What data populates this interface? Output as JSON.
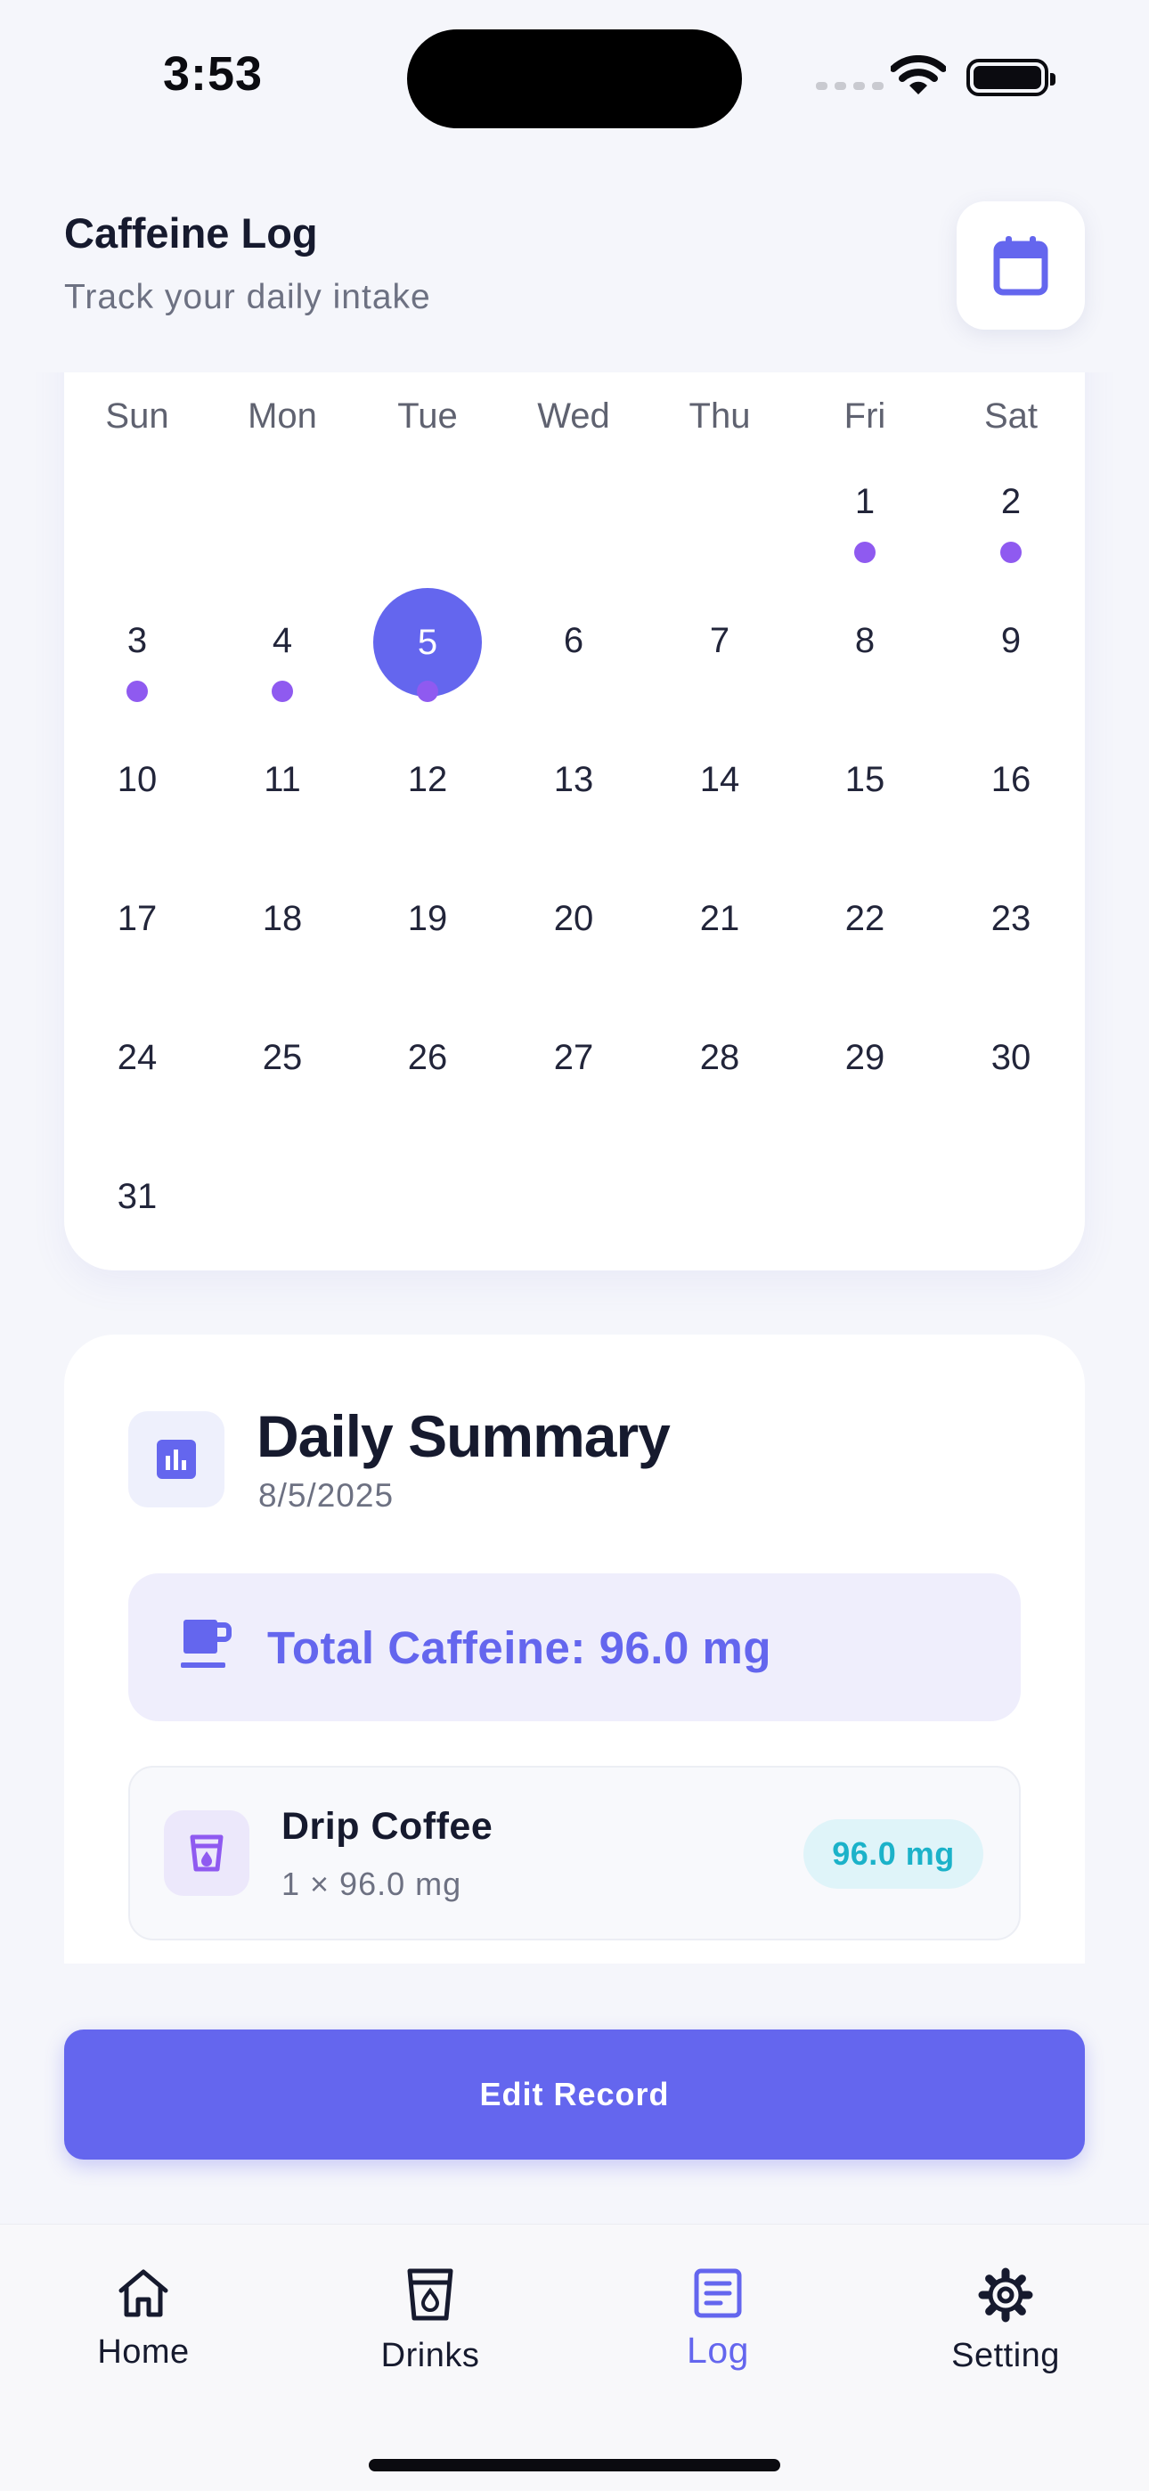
{
  "status_bar": {
    "time": "3:53"
  },
  "header": {
    "title": "Caffeine Log",
    "subtitle": "Track your daily intake",
    "calendar_icon": "calendar-icon"
  },
  "calendar": {
    "weekdays": [
      "Sun",
      "Mon",
      "Tue",
      "Wed",
      "Thu",
      "Fri",
      "Sat"
    ],
    "days": [
      "1",
      "2",
      "3",
      "4",
      "5",
      "6",
      "7",
      "8",
      "9",
      "10",
      "11",
      "12",
      "13",
      "14",
      "15",
      "16",
      "17",
      "18",
      "19",
      "20",
      "21",
      "22",
      "23",
      "24",
      "25",
      "26",
      "27",
      "28",
      "29",
      "30",
      "31"
    ],
    "selected_day": "5",
    "days_with_entries": [
      "1",
      "2",
      "3",
      "4",
      "5"
    ],
    "accent_color": "#6466ee",
    "dot_color": "#8f5af0"
  },
  "summary": {
    "title": "Daily Summary",
    "date": "8/5/2025",
    "icon": "bar-chart-icon",
    "total_label": "Total Caffeine: 96.0 mg",
    "total_icon": "coffee-cup-icon",
    "items": [
      {
        "name": "Drip Coffee",
        "detail": "1 × 96.0 mg",
        "amount": "96.0 mg",
        "icon": "drink-cup-icon"
      }
    ]
  },
  "edit_button": {
    "label": "Edit Record"
  },
  "tabs": [
    {
      "label": "Home",
      "icon": "home-icon",
      "active": false
    },
    {
      "label": "Drinks",
      "icon": "cup-icon",
      "active": false
    },
    {
      "label": "Log",
      "icon": "log-icon",
      "active": true
    },
    {
      "label": "Setting",
      "icon": "gear-icon",
      "active": false
    }
  ]
}
